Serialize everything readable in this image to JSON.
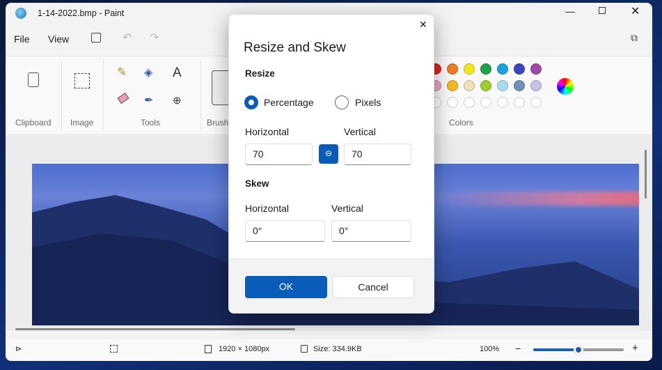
{
  "window": {
    "title": "1-14-2022.bmp - Paint"
  },
  "menu": {
    "file": "File",
    "view": "View"
  },
  "ribbon": {
    "groups": [
      "Clipboard",
      "Image",
      "Tools",
      "Brushes",
      "Colors"
    ]
  },
  "colors": {
    "row1": [
      "#e02424",
      "#f07a28",
      "#f5e61c",
      "#22a04a",
      "#1aa3e0",
      "#3a46c0",
      "#a04aa8"
    ],
    "row2": [
      "#e8a8c0",
      "#f5b820",
      "#eee0b8",
      "#9ccc30",
      "#a8dcec",
      "#7090c0",
      "#c8c0e8"
    ]
  },
  "status": {
    "dimensions": "1920 × 1080px",
    "size": "Size: 334.9KB",
    "zoom": "100%",
    "zoom_fraction": 0.5
  },
  "dialog": {
    "title": "Resize and Skew",
    "resize_heading": "Resize",
    "percentage": "Percentage",
    "pixels": "Pixels",
    "selected_unit": "Percentage",
    "horizontal_label": "Horizontal",
    "vertical_label": "Vertical",
    "resize_h": "70",
    "resize_v": "70",
    "skew_heading": "Skew",
    "skew_h_label": "Horizontal",
    "skew_v_label": "Vertical",
    "skew_h": "0°",
    "skew_v": "0°",
    "ok": "OK",
    "cancel": "Cancel"
  }
}
